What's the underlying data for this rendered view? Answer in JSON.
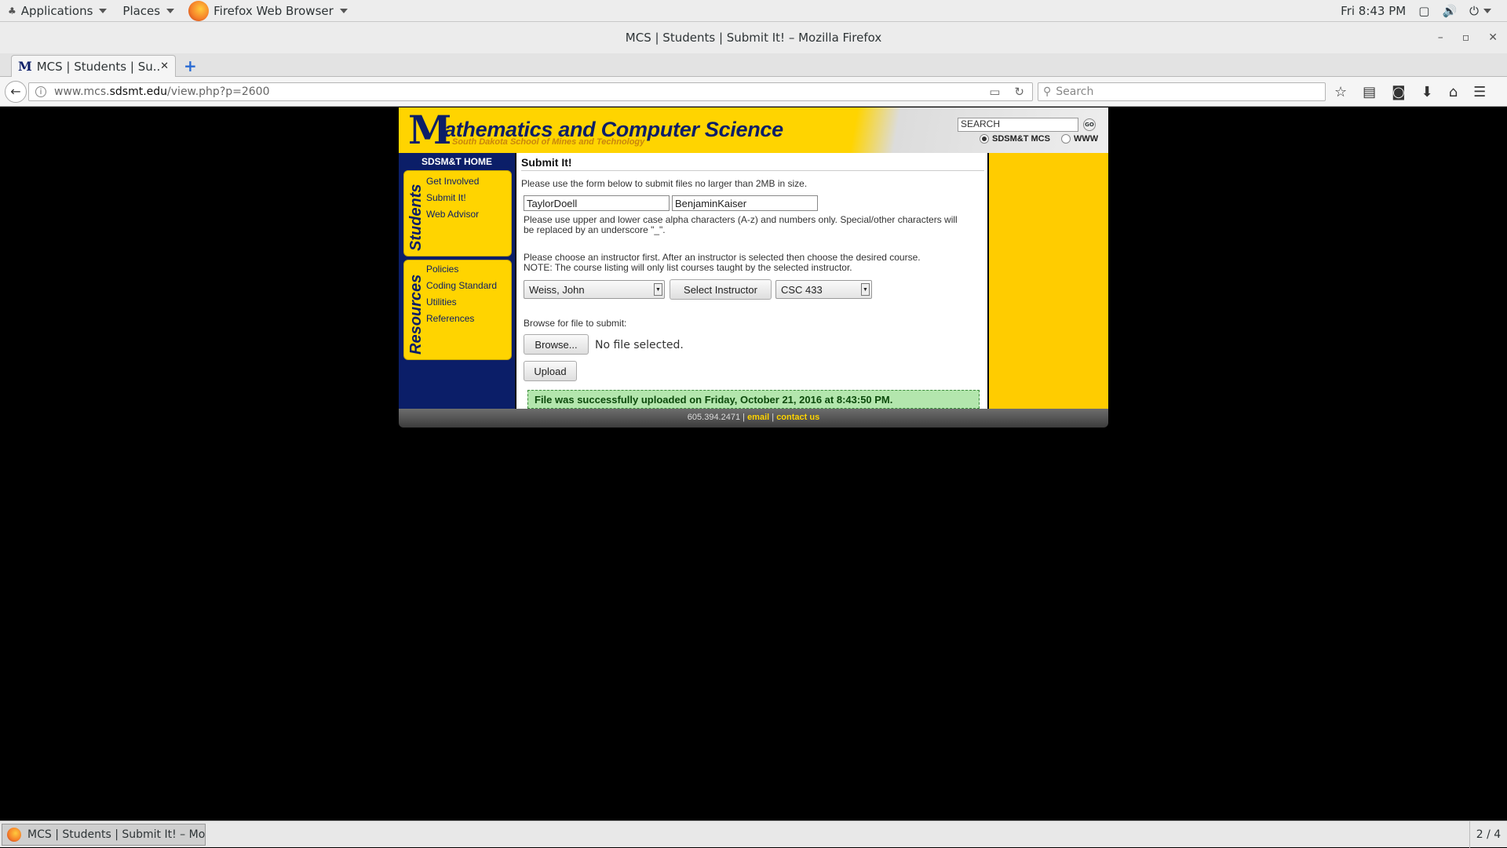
{
  "desktop": {
    "applications": "Applications",
    "places": "Places",
    "browser_app": "Firefox Web Browser",
    "clock": "Fri  8:43 PM"
  },
  "window": {
    "title": "MCS | Students | Submit It! – Mozilla Firefox"
  },
  "tab": {
    "title": "MCS | Students | Su..."
  },
  "address": {
    "scheme_host_pre": "www.mcs.",
    "domain": "sdsmt.edu",
    "path": "/view.php?p=2600"
  },
  "search": {
    "placeholder": "Search"
  },
  "site": {
    "logo_letter": "M",
    "logo_text": "athematics and Computer Science",
    "logo_sub": "South Dakota School of Mines and Technology",
    "search_value": "SEARCH",
    "go_label": "GO",
    "radio_mcs": "SDSM&T MCS",
    "radio_www": "WWW",
    "home_link": "SDSM&T HOME",
    "students_heading": "Students",
    "students_links": [
      "Get Involved",
      "Submit It!",
      "Web Advisor"
    ],
    "resources_heading": "Resources",
    "resources_links": [
      "Policies",
      "Coding Standard",
      "Utilities",
      "References"
    ]
  },
  "form": {
    "title": "Submit It!",
    "intro": "Please use the form below to submit files no larger than 2MB in size.",
    "name1": "TaylorDoell",
    "name2": "BenjaminKaiser",
    "note1a": "Please use upper and lower case alpha characters (A-z) and numbers only. Special/other characters will",
    "note1b": "be replaced by an underscore \"_\".",
    "note2a": "Please choose an instructor first. After an instructor is selected then choose the desired course.",
    "note2b": "NOTE: The course listing will only list courses taught by the selected instructor.",
    "instructor": "Weiss, John",
    "select_instructor": "Select Instructor",
    "course": "CSC 433",
    "browse_label": "Browse for file to submit:",
    "browse_btn": "Browse...",
    "file_status": "No file selected.",
    "upload": "Upload",
    "success": "File was successfully uploaded on Friday, October 21, 2016 at 8:43:50 PM."
  },
  "footer": {
    "phone": "605.394.2471 |",
    "email": "email",
    "sep": "|",
    "contact": "contact us"
  },
  "taskbar": {
    "item": "MCS | Students | Submit It! – Moz...",
    "pager": "2 / 4"
  }
}
